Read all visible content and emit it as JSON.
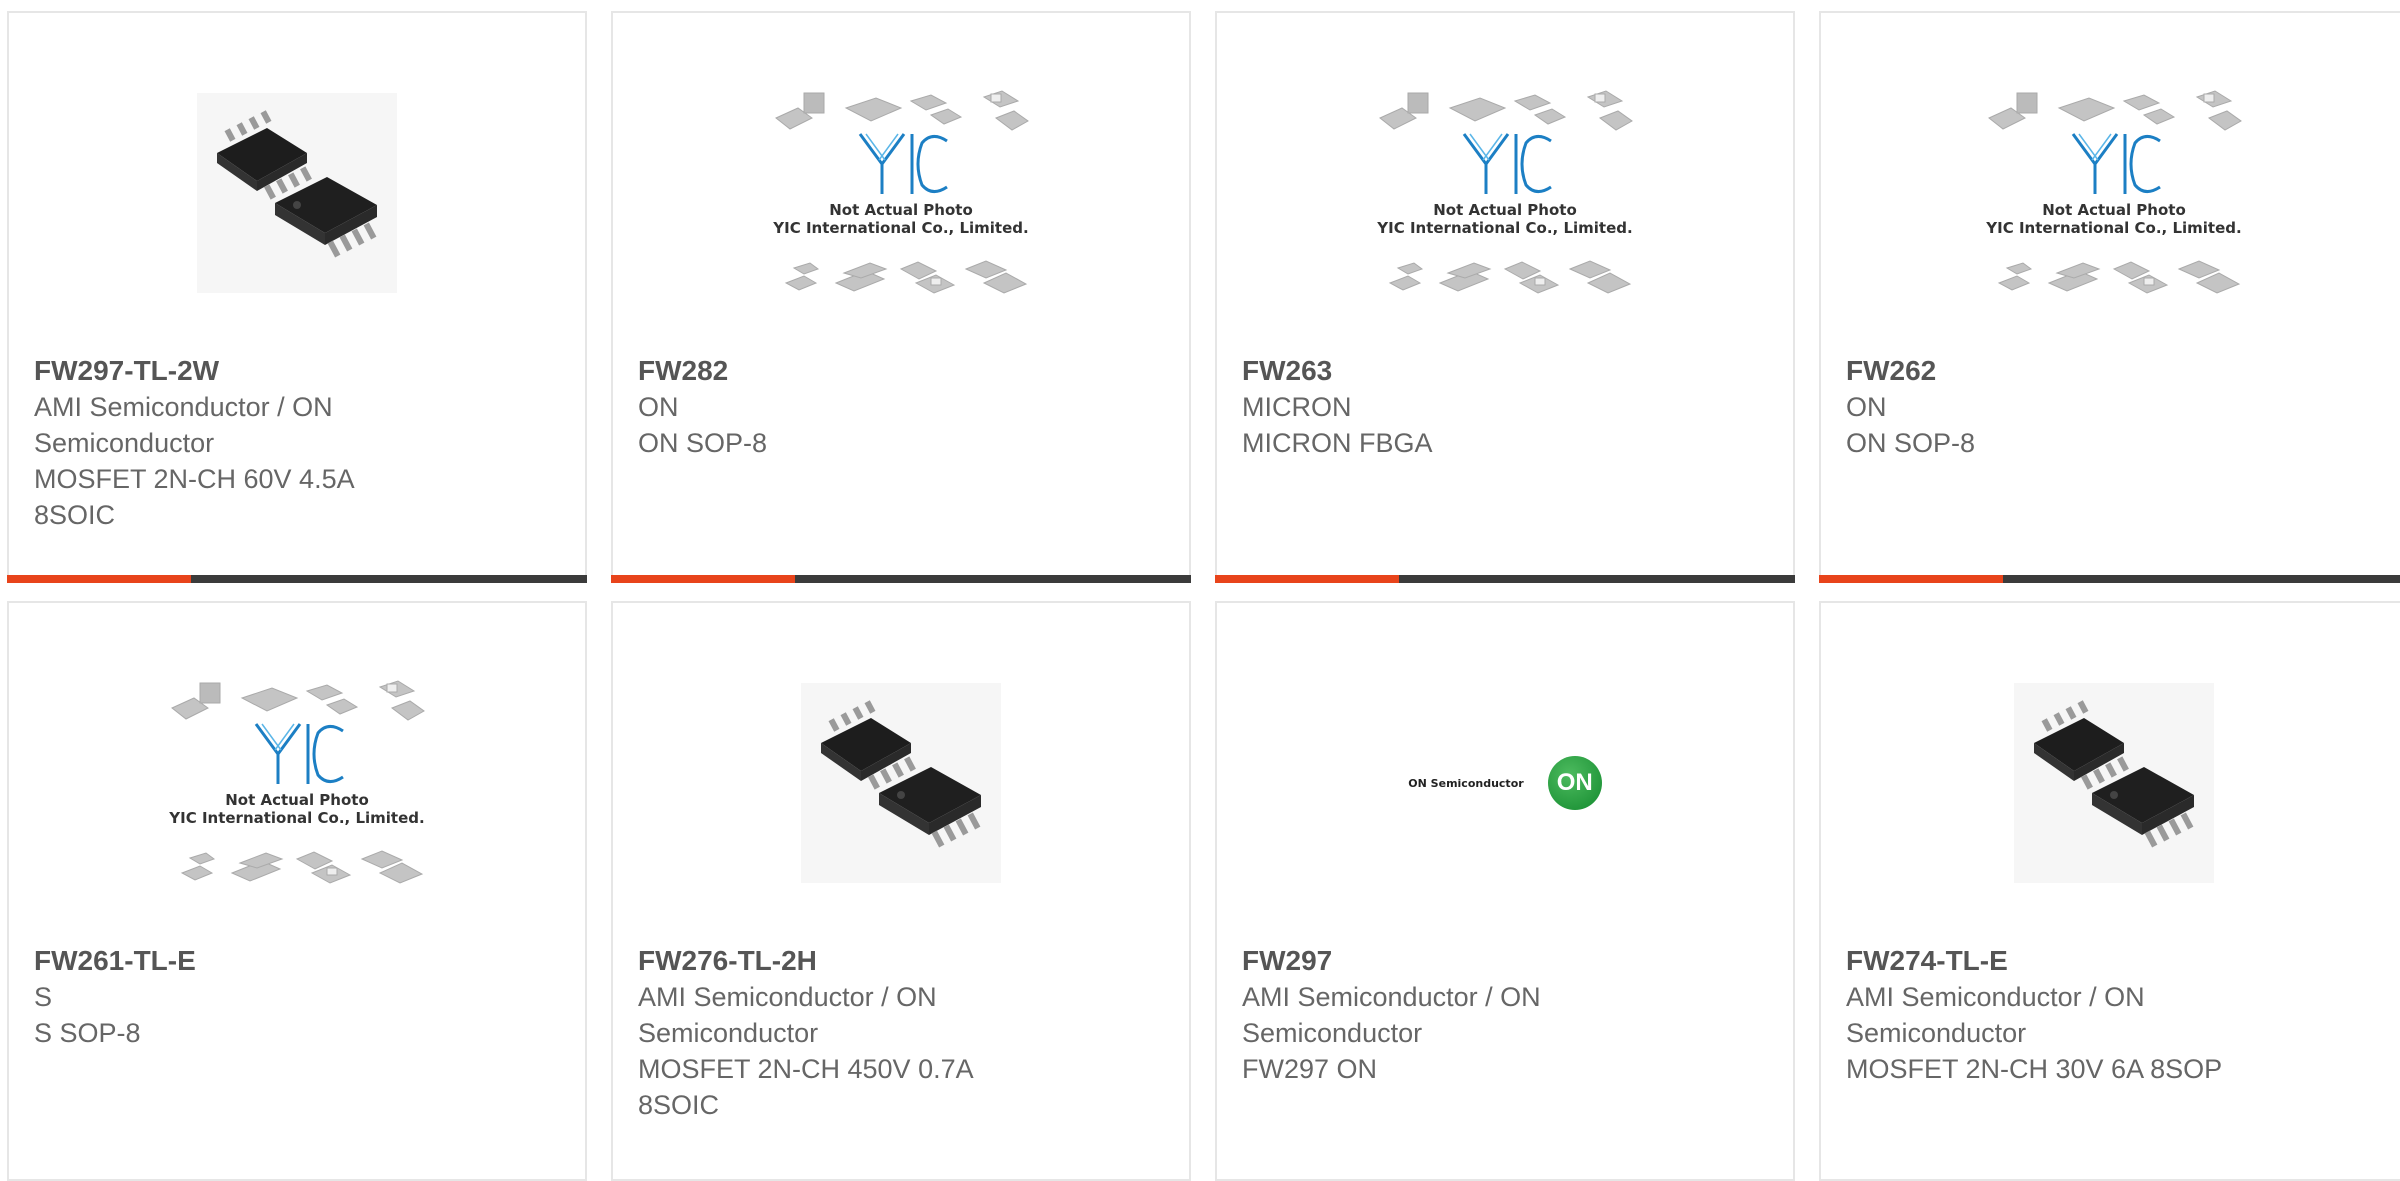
{
  "colors": {
    "accent": "#e8441b",
    "bar": "#3b3b3b",
    "border": "#e6e6e6",
    "text": "#666666"
  },
  "placeholder": {
    "line1": "Not Actual Photo",
    "line2": "YIC International Co., Limited.",
    "logo": "YIC"
  },
  "onlogo": {
    "text": "ON Semiconductor",
    "mark": "ON"
  },
  "products": [
    {
      "pn": "FW297-TL-2W",
      "mfr": "AMI Semiconductor / ON Semiconductor",
      "desc": "MOSFET 2N-CH 60V 4.5A 8SOIC",
      "image": "soic-photo"
    },
    {
      "pn": "FW282",
      "mfr": "ON",
      "desc": "ON SOP-8",
      "image": "placeholder"
    },
    {
      "pn": "FW263",
      "mfr": "MICRON",
      "desc": "MICRON FBGA",
      "image": "placeholder"
    },
    {
      "pn": "FW262",
      "mfr": "ON",
      "desc": "ON SOP-8",
      "image": "placeholder"
    },
    {
      "pn": "FW261-TL-E",
      "mfr": "S",
      "desc": "S SOP-8",
      "image": "placeholder"
    },
    {
      "pn": "FW276-TL-2H",
      "mfr": "AMI Semiconductor / ON Semiconductor",
      "desc": "MOSFET 2N-CH 450V 0.7A 8SOIC",
      "image": "soic-photo"
    },
    {
      "pn": "FW297",
      "mfr": "AMI Semiconductor / ON Semiconductor",
      "desc": "FW297 ON",
      "image": "on-logo"
    },
    {
      "pn": "FW274-TL-E",
      "mfr": "AMI Semiconductor / ON Semiconductor",
      "desc": "MOSFET 2N-CH 30V 6A 8SOP",
      "image": "soic-photo"
    }
  ]
}
